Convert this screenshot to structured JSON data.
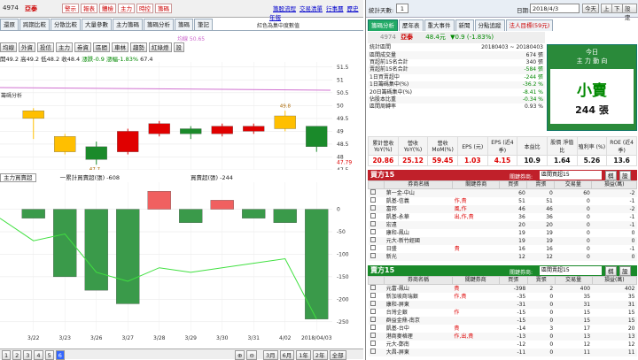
{
  "top": {
    "stock_code": "4974",
    "stock_name": "亞泰",
    "red_buttons": [
      "警示",
      "報表",
      "體檢",
      "主力",
      "時控",
      "籌碼"
    ],
    "links": [
      "籌股流程",
      "交易清單",
      "行事曆",
      "歷史年報"
    ],
    "blue_sub_buttons": [
      "籌碼",
      "漲幅",
      "指標",
      "趨勢",
      "漲點"
    ]
  },
  "left_tabs": [
    "還原",
    "跨期比較",
    "分散比較",
    "大量參數",
    "主力籌碼",
    "籌碼分析",
    "籌碼",
    "筆記"
  ],
  "chart_toolbar": [
    "均線",
    "外資",
    "投信",
    "主力",
    "券資",
    "區間",
    "車林",
    "趨勢",
    "紅綠燈",
    "設"
  ],
  "ohlc": {
    "open_label": "開",
    "open": "49.2",
    "high_label": "高",
    "high": "49.2",
    "low_label": "低",
    "low": "48.2",
    "close_label": "收",
    "close": "48.4",
    "chg_label": "漲跌",
    "chg": "-0.9",
    "pct_label": "漲幅",
    "pct": "-1.83%",
    "extra": "67.4"
  },
  "note_red": "紅色為集中度數值",
  "ma_label": "均線 50.65",
  "left_sidebar": "籌碼分析",
  "price_axis": [
    "51.5",
    "51",
    "50.5",
    "50",
    "49.5",
    "49",
    "48.5",
    "48",
    "47.79",
    "47.5"
  ],
  "vol_axis": [
    "0",
    "-50",
    "-100",
    "-150",
    "-200",
    "-250"
  ],
  "chart_data": {
    "type": "bar",
    "categories": [
      "3/22",
      "3/23",
      "3/26",
      "3/27",
      "3/28",
      "3/29",
      "3/30",
      "3/31",
      "4/02",
      "2018/04/03"
    ],
    "candles": [
      {
        "o": 49.5,
        "c": 49.8,
        "h": 49.9,
        "l": 48.7
      },
      {
        "o": 48.8,
        "c": 48.2,
        "h": 48.9,
        "l": 48.1
      },
      {
        "o": 48.4,
        "c": 47.9,
        "h": 48.6,
        "l": 47.7
      },
      {
        "o": 48.2,
        "c": 49.0,
        "h": 49.1,
        "l": 48.1
      },
      {
        "o": 48.9,
        "c": 49.3,
        "h": 49.4,
        "l": 48.8
      },
      {
        "o": 49.1,
        "c": 48.9,
        "h": 49.2,
        "l": 48.7
      },
      {
        "o": 48.9,
        "c": 49.2,
        "h": 49.3,
        "l": 48.8
      },
      {
        "o": 49.0,
        "c": 49.2,
        "h": 49.3,
        "l": 48.9
      },
      {
        "o": 49.1,
        "c": 49.6,
        "h": 49.8,
        "l": 49.0
      },
      {
        "o": 49.2,
        "c": 48.4,
        "h": 49.2,
        "l": 48.2
      }
    ],
    "price_labels": [
      "49.8",
      "47.7"
    ],
    "ylim": [
      47.5,
      51.7
    ],
    "volume": [
      -20,
      -150,
      -180,
      -210,
      40,
      -30,
      20,
      -20,
      -30,
      -244
    ],
    "vol_ylim": [
      -270,
      60
    ],
    "line": [
      -70,
      -55,
      -140,
      -160,
      -130,
      -140,
      -130,
      -120,
      -110,
      -244
    ]
  },
  "vol_header": {
    "select": "主力買賣超",
    "text": "一累計買賣超(張) -608",
    "legend": "買賣超(張) -244"
  },
  "bottom_nav": {
    "pages": [
      "1",
      "2",
      "3",
      "4",
      "5",
      "6"
    ],
    "ranges": [
      "3月",
      "6月",
      "1年",
      "2年",
      "全部",
      "還原"
    ]
  },
  "right_top": {
    "label": "統計天數:",
    "days": "1",
    "date_label": "日期:",
    "date": "2018/4/3",
    "today_btn": "今天",
    "prev": "上",
    "next": "下",
    "settings": "設定"
  },
  "right_tabs": [
    "籌碼分析",
    "歷年表",
    "重大事件",
    "新聞",
    "分點追蹤",
    "法人目標(59元)"
  ],
  "quote": {
    "code": "4974",
    "name": "亞泰",
    "price": "48.4元",
    "chg": "▼0.9 (-1.83%)"
  },
  "stats": [
    {
      "k": "統計區間",
      "v": "20180403 ~ 20180403"
    },
    {
      "k": "區間成交量",
      "v": "674 張"
    },
    {
      "k": "買超前15名合計",
      "v": "340 張"
    },
    {
      "k": "賣超前15名合計",
      "v": "-584 張"
    },
    {
      "k": "1日買賣超中",
      "v": "-244 張"
    },
    {
      "k": "1日籌碼集中(%)",
      "v": "-36.2 %"
    },
    {
      "k": "20日籌碼集中(%)",
      "v": "-8.41 %"
    },
    {
      "k": "佔股本比重",
      "v": "-0.34 %"
    },
    {
      "k": "區間周轉率",
      "v": "0.93 %"
    }
  ],
  "today": {
    "title": "今日",
    "sub": "主 力 動 向",
    "action": "小賣",
    "amount": "244 張"
  },
  "metrics": {
    "labels": [
      "累計營收 YoY(%)",
      "營收 YoY(%)",
      "營收 MoM(%)",
      "EPS (元)",
      "EPS (近4季)",
      "本益比",
      "股價 淨值比",
      "殖利率 (%)",
      "ROE (近4季)"
    ],
    "values": [
      "20.86",
      "25.12",
      "59.45",
      "1.03",
      "4.15",
      "10.9",
      "1.64",
      "5.26",
      "13.6"
    ]
  },
  "buy_section": {
    "title": "買方15",
    "param_label": "關鍵券商:",
    "param": "區間買超15",
    "btn1": "棋",
    "btn2": "設",
    "headers": [
      "券商名稱",
      "關鍵券商",
      "買張",
      "賣張",
      "交易量",
      "損益(萬)"
    ],
    "rows": [
      [
        "第一金-中山",
        "",
        "60",
        "0",
        "60",
        "-2"
      ],
      [
        "凱基-信義",
        "作,貴",
        "51",
        "51",
        "0",
        "-1"
      ],
      [
        "富邦",
        "風,作",
        "46",
        "46",
        "0",
        "-2"
      ],
      [
        "凱基-永華",
        "出,作,貴",
        "36",
        "36",
        "0",
        "-1"
      ],
      [
        "宏遠",
        "",
        "20",
        "20",
        "0",
        "-1"
      ],
      [
        "康和-鳳山",
        "",
        "19",
        "19",
        "0",
        "0"
      ],
      [
        "元大-新竹經國",
        "",
        "19",
        "19",
        "0",
        "0"
      ],
      [
        "日盛",
        "貴",
        "16",
        "16",
        "0",
        "-1"
      ],
      [
        "新光",
        "",
        "12",
        "12",
        "0",
        "0"
      ]
    ]
  },
  "sell_section": {
    "title": "賣方15",
    "param_label": "關鍵券商:",
    "param": "區間賣超15",
    "btn1": "棋",
    "btn2": "設",
    "headers": [
      "券商名稱",
      "關鍵券商",
      "買張",
      "賣張",
      "交易量",
      "損益(萬)"
    ],
    "rows": [
      [
        "元富-鳳山",
        "貴",
        "-398",
        "2",
        "400",
        "402"
      ],
      [
        "新加坡商瑞銀",
        "作,貴",
        "-35",
        "0",
        "35",
        "35"
      ],
      [
        "康和-屏東",
        "",
        "-31",
        "0",
        "31",
        "31"
      ],
      [
        "台灣企銀",
        "作",
        "-15",
        "0",
        "15",
        "15"
      ],
      [
        "群益金鼎-南京",
        "",
        "-15",
        "0",
        "15",
        "15"
      ],
      [
        "凱基-台中",
        "貴",
        "-14",
        "3",
        "17",
        "20"
      ],
      [
        "港商麥格理",
        "作,出,貴",
        "-13",
        "0",
        "13",
        "13"
      ],
      [
        "元大-鄭南",
        "",
        "-12",
        "0",
        "12",
        "12"
      ],
      [
        "大昌-屏東",
        "",
        "-11",
        "0",
        "11",
        "11"
      ]
    ]
  },
  "colors": {
    "red": "#e00000",
    "green": "#1a8a2a",
    "yellow": "#ffbf00",
    "darkgreen": "#006b1a"
  }
}
